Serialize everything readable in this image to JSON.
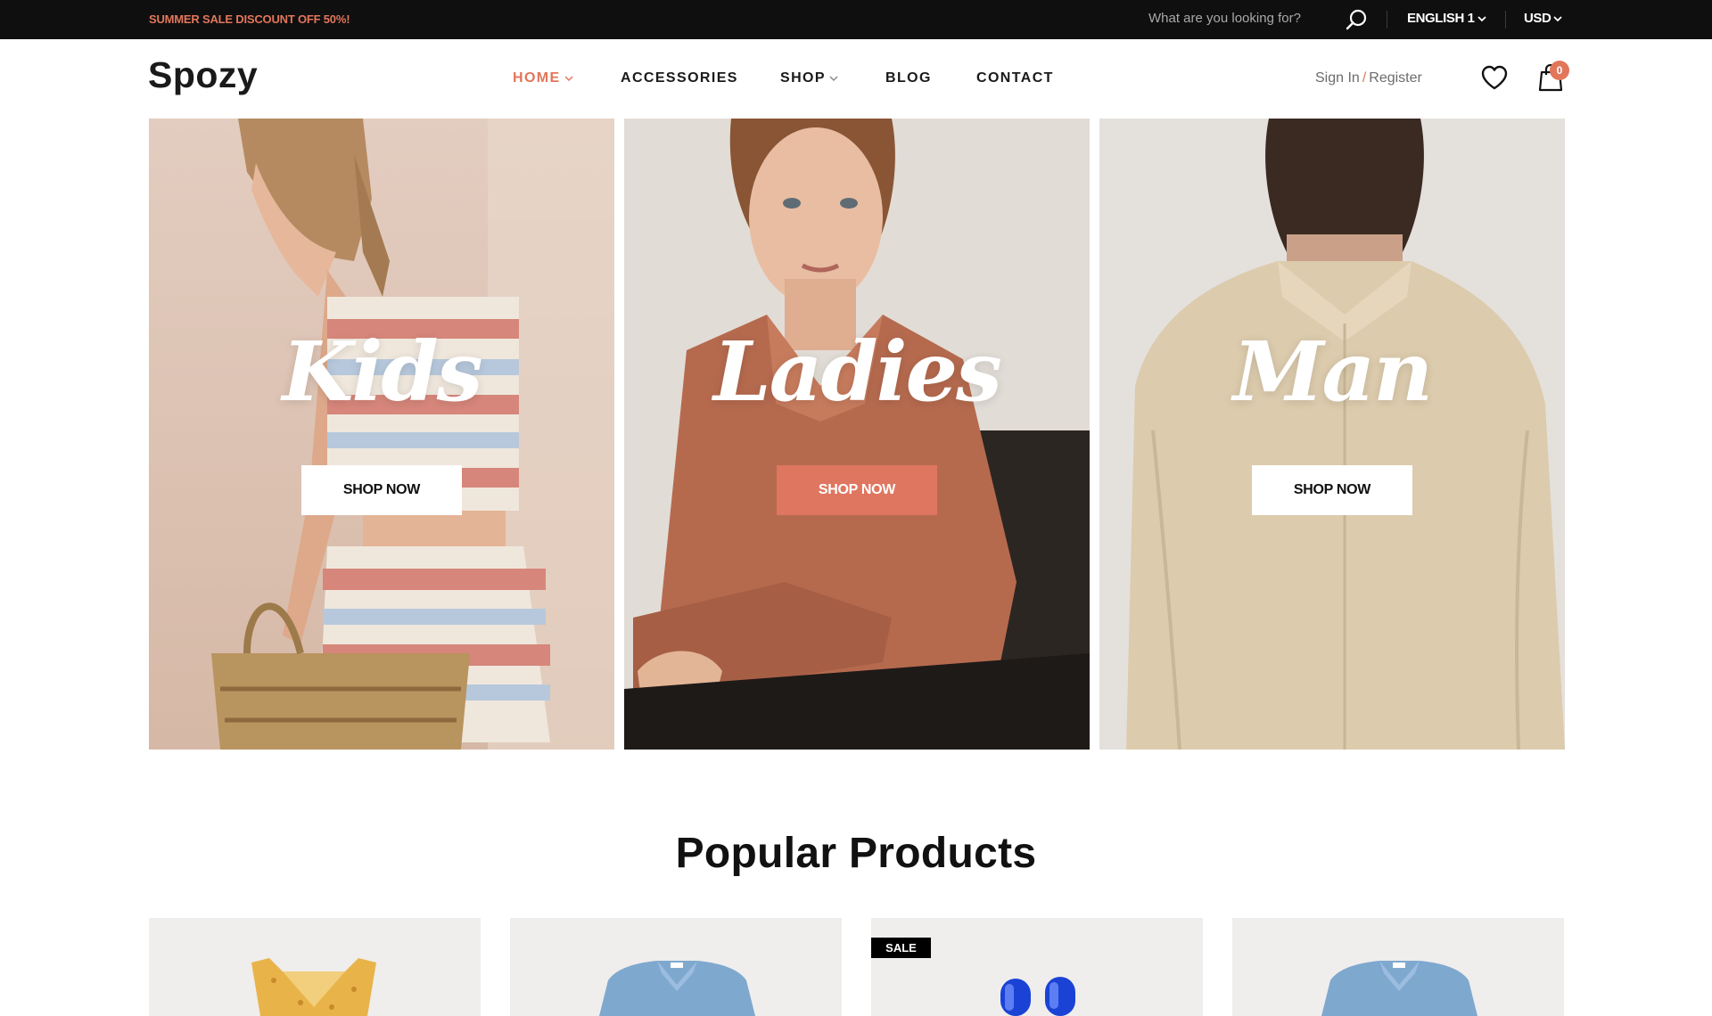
{
  "topbar": {
    "promo": "SUMMER SALE DISCOUNT OFF 50%!",
    "search_placeholder": "What are you looking for?",
    "language": "ENGLISH 1",
    "currency": "USD"
  },
  "header": {
    "logo": "Spozy",
    "nav": [
      {
        "label": "HOME",
        "active": true,
        "dropdown": true
      },
      {
        "label": "ACCESSORIES",
        "active": false,
        "dropdown": false
      },
      {
        "label": "SHOP",
        "active": false,
        "dropdown": true
      },
      {
        "label": "BLOG",
        "active": false,
        "dropdown": false
      },
      {
        "label": "CONTACT",
        "active": false,
        "dropdown": false
      }
    ],
    "sign_in": "Sign In",
    "separator": "/",
    "register": "Register",
    "cart_count": "0"
  },
  "banners": [
    {
      "title": "Kids",
      "button": "SHOP NOW",
      "accent": false
    },
    {
      "title": "Ladies",
      "button": "SHOP NOW",
      "accent": true
    },
    {
      "title": "Man",
      "button": "SHOP NOW",
      "accent": false
    }
  ],
  "popular": {
    "title": "Popular Products",
    "products": [
      {
        "badge": ""
      },
      {
        "badge": ""
      },
      {
        "badge": "SALE"
      },
      {
        "badge": ""
      }
    ]
  },
  "colors": {
    "accent": "#e2765a",
    "topbar_bg": "#0f0f10",
    "button_accent": "#df7660"
  },
  "icons": [
    "search-icon",
    "chevron-down-icon",
    "heart-icon",
    "shopping-bag-icon"
  ]
}
